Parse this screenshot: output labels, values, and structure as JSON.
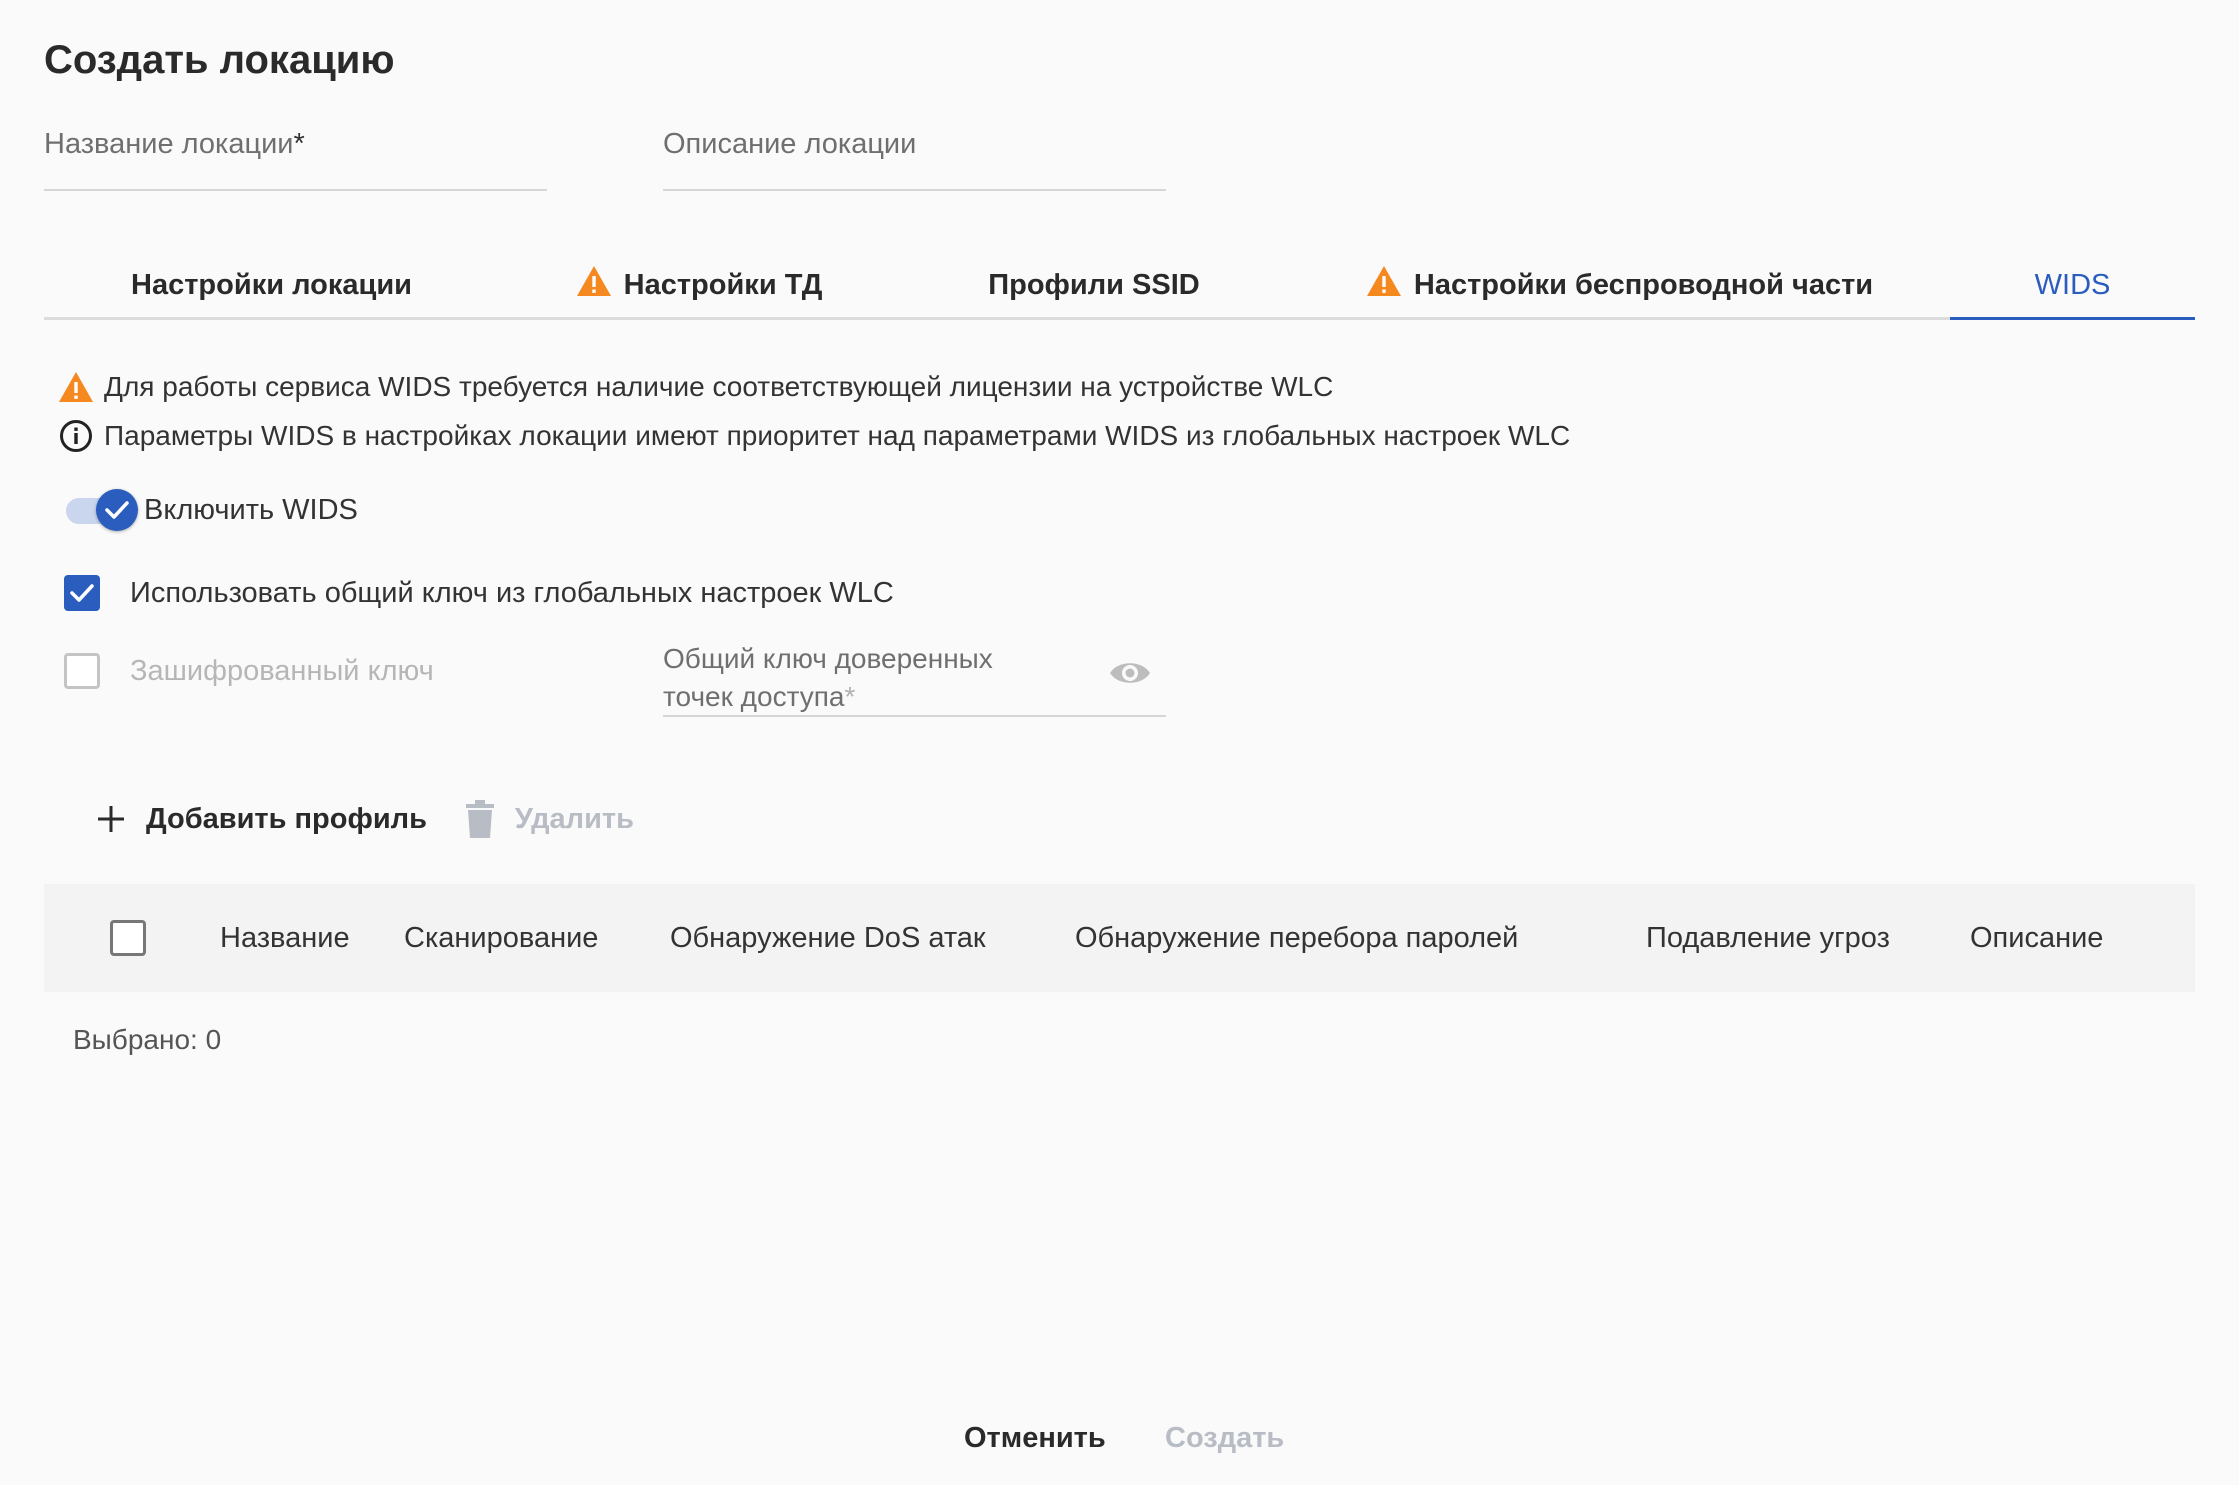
{
  "page": {
    "title": "Создать локацию"
  },
  "form": {
    "name_label": "Название локации",
    "name_required": "*",
    "description_label": "Описание локации"
  },
  "tabs": [
    {
      "label": "Настройки локации",
      "warning": false,
      "active": false
    },
    {
      "label": "Настройки ТД",
      "warning": true,
      "active": false
    },
    {
      "label": "Профили SSID",
      "warning": false,
      "active": false
    },
    {
      "label": "Настройки беспроводной части",
      "warning": true,
      "active": false
    },
    {
      "label": "WIDS",
      "warning": false,
      "active": true
    }
  ],
  "wids": {
    "license_warning": "Для работы сервиса WIDS требуется наличие соответствующей лицензии на устройстве WLC",
    "priority_info": "Параметры WIDS в настройках локации имеют приоритет над параметрами WIDS из глобальных настроек WLC",
    "enable_label": "Включить WIDS",
    "enable_value": true,
    "use_global_key_label": "Использовать общий ключ из глобальных настроек WLC",
    "use_global_key_value": true,
    "encrypted_key_label": "Зашифрованный ключ",
    "encrypted_key_value": false,
    "trusted_key_label": "Общий ключ доверенных точек доступа",
    "trusted_key_required": "*"
  },
  "toolbar": {
    "add_label": "Добавить профиль",
    "delete_label": "Удалить"
  },
  "table": {
    "columns": [
      "Название",
      "Сканирование",
      "Обнаружение DoS атак",
      "Обнаружение перебора паролей",
      "Подавление угроз",
      "Описание"
    ],
    "rows": []
  },
  "selection": {
    "text": "Выбрано: 0"
  },
  "footer": {
    "cancel_label": "Отменить",
    "create_label": "Создать"
  },
  "colors": {
    "accent": "#2b5dbf",
    "warning": "#f5891f",
    "disabled": "#b8bcc4"
  }
}
